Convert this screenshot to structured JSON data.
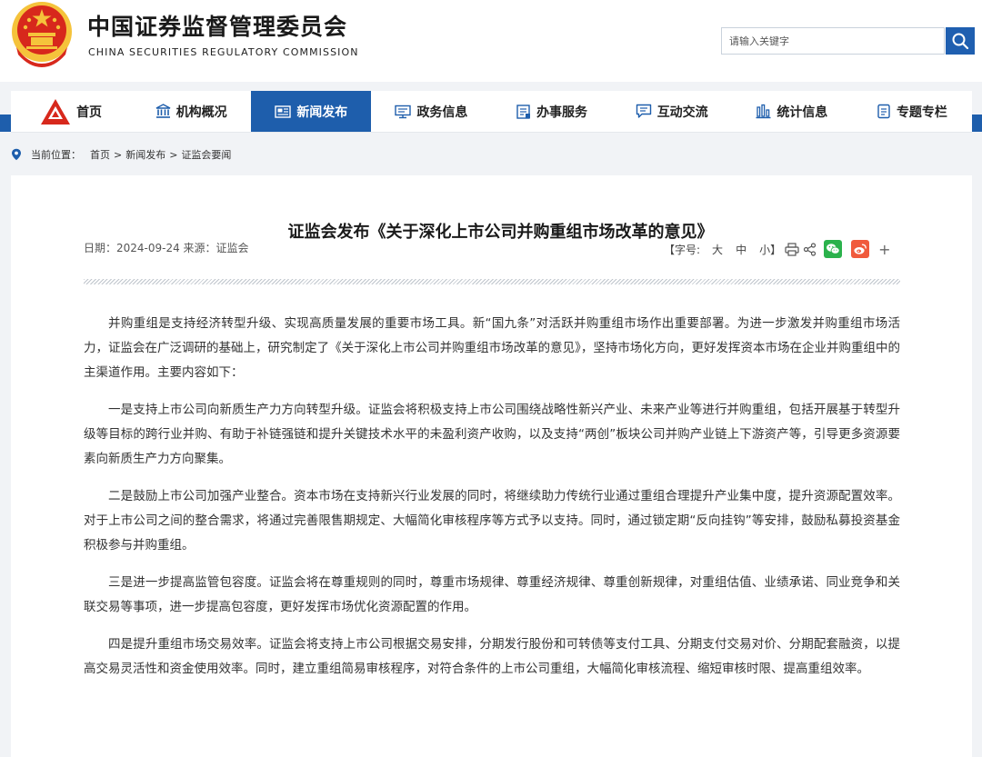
{
  "header": {
    "title_cn": "中国证券监督管理委员会",
    "title_en": "CHINA SECURITIES REGULATORY COMMISSION",
    "search_placeholder": "请输入关键字",
    "colors": {
      "emblem_red": "#d7281c",
      "emblem_gold": "#f5c33b",
      "brand_blue": "#1e5eac"
    }
  },
  "nav": {
    "items": [
      {
        "label": "首页",
        "icon": "csrc-logo-icon"
      },
      {
        "label": "机构概况",
        "icon": "building-icon"
      },
      {
        "label": "新闻发布",
        "icon": "newspaper-icon",
        "active": true
      },
      {
        "label": "政务信息",
        "icon": "monitor-icon"
      },
      {
        "label": "办事服务",
        "icon": "clipboard-icon"
      },
      {
        "label": "互动交流",
        "icon": "chat-bubble-icon"
      },
      {
        "label": "统计信息",
        "icon": "bar-chart-icon"
      },
      {
        "label": "专题专栏",
        "icon": "document-icon"
      }
    ]
  },
  "breadcrumb": {
    "prefix": "当前位置：",
    "items": [
      "首页",
      "新闻发布",
      "证监会要闻"
    ]
  },
  "article": {
    "title": "证监会发布《关于深化上市公司并购重组市场改革的意见》",
    "meta": "日期：2024-09-24 来源：证监会",
    "font_size_label": "【字号:",
    "font_sizes": [
      "大",
      "中",
      "小"
    ],
    "font_size_close": "】",
    "share_icons": [
      "print-icon",
      "share-icon",
      "wechat-icon",
      "weibo-icon",
      "plus-icon"
    ],
    "plus": "+",
    "paragraphs": [
      "并购重组是支持经济转型升级、实现高质量发展的重要市场工具。新“国九条”对活跃并购重组市场作出重要部署。为进一步激发并购重组市场活力，证监会在广泛调研的基础上，研究制定了《关于深化上市公司并购重组市场改革的意见》，坚持市场化方向，更好发挥资本市场在企业并购重组中的主渠道作用。主要内容如下：",
      "一是支持上市公司向新质生产力方向转型升级。证监会将积极支持上市公司围绕战略性新兴产业、未来产业等进行并购重组，包括开展基于转型升级等目标的跨行业并购、有助于补链强链和提升关键技术水平的未盈利资产收购，以及支持“两创”板块公司并购产业链上下游资产等，引导更多资源要素向新质生产力方向聚集。",
      "二是鼓励上市公司加强产业整合。资本市场在支持新兴行业发展的同时，将继续助力传统行业通过重组合理提升产业集中度，提升资源配置效率。对于上市公司之间的整合需求，将通过完善限售期规定、大幅简化审核程序等方式予以支持。同时，通过锁定期“反向挂钩”等安排，鼓励私募投资基金积极参与并购重组。",
      "三是进一步提高监管包容度。证监会将在尊重规则的同时，尊重市场规律、尊重经济规律、尊重创新规律，对重组估值、业绩承诺、同业竞争和关联交易等事项，进一步提高包容度，更好发挥市场优化资源配置的作用。",
      "四是提升重组市场交易效率。证监会将支持上市公司根据交易安排，分期发行股份和可转债等支付工具、分期支付交易对价、分期配套融资，以提高交易灵活性和资金使用效率。同时，建立重组简易审核程序，对符合条件的上市公司重组，大幅简化审核流程、缩短审核时限、提高重组效率。"
    ]
  }
}
